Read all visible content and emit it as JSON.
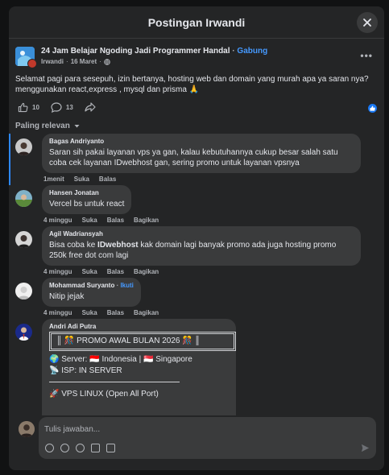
{
  "modal": {
    "title": "Postingan Irwandi"
  },
  "post": {
    "group_name": "24 Jam Belajar Ngoding Jadi Programmer Handal",
    "join_label": "Gabung",
    "author": "Irwandi",
    "date": "16 Maret",
    "text": "Selamat pagi para sesepuh, izin bertanya, hosting web dan domain yang murah apa ya saran nya? menggunakan react,express , mysql dan prisma 🙏",
    "like_count": "10",
    "comment_count": "13"
  },
  "sort": {
    "label": "Paling relevan"
  },
  "comments": [
    {
      "name": "Bagas Andriyanto",
      "text": "Saran sih pakai layanan vps ya gan, kalau kebutuhannya cukup besar salah satu coba cek layanan IDwebhost gan, sering promo untuk layanan vpsnya",
      "time": "1menit",
      "like": "Suka",
      "reply": "Balas"
    },
    {
      "name": "Hansen Jonatan",
      "text": "Vercel bs untuk react",
      "time": "4 minggu",
      "like": "Suka",
      "reply": "Balas",
      "share": "Bagikan"
    },
    {
      "name": "Agil Wadriansyah",
      "text_pre": "Bisa coba ke ",
      "text_bold": "IDwebhost",
      "text_post": " kak domain lagi banyak promo ada juga hosting promo 250k free dot com lagi",
      "time": "4 minggu",
      "like": "Suka",
      "reply": "Balas",
      "share": "Bagikan"
    },
    {
      "name": "Mohammad Suryanto",
      "follow": "Ikuti",
      "text": "Nitip jejak",
      "time": "4 minggu",
      "like": "Suka",
      "reply": "Balas",
      "share": "Bagikan"
    },
    {
      "name": "Andri Adi Putra",
      "promo_title": "║ 🎊 PROMO AWAL BULAN 2026 🎊 ║",
      "server": "🌍 Server: 🇮🇩 Indonesia | 🇸🇬 Singapore",
      "isp": "📡 ISP: IN SERVER",
      "vps": "🚀 VPS LINUX (Open All Port)"
    }
  ],
  "reply": {
    "placeholder": "Tulis jawaban..."
  },
  "colors": {
    "background": "#242526",
    "bubble": "#3a3b3c",
    "accent": "#4599ff",
    "like_blue": "#1877f2"
  }
}
